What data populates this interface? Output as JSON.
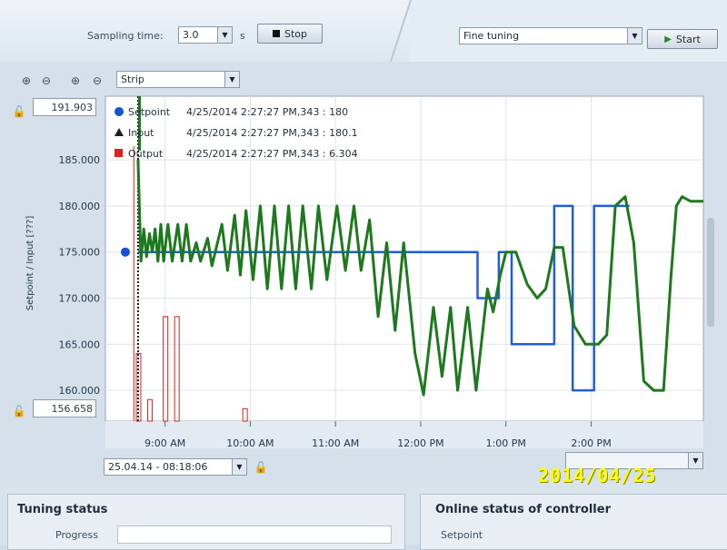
{
  "toolbar": {
    "sampling_label": "Sampling time:",
    "sampling_value": "3.0",
    "unit_label": "s",
    "stop_label": "Stop",
    "tuning_mode_value": "Fine tuning",
    "start_label": "Start",
    "view_mode_value": "Strip"
  },
  "chart": {
    "y_max_readout": "191.903",
    "y_min_readout": "156.658",
    "y_axis_label": "Setpoint / Input  [???]",
    "time_start": "25.04.14 - 08:18:06",
    "legend": [
      {
        "name": "Setpoint",
        "text": "4/25/2014 2:27:27 PM,343 : 180",
        "color": "#1a4fd6",
        "marker": "circle"
      },
      {
        "name": "Input",
        "text": "4/25/2014 2:27:27 PM,343 : 180.1",
        "color": "#1e1e1e",
        "marker": "triangle"
      },
      {
        "name": "Output",
        "text": "4/25/2014 2:27:27 PM,343 : 6.304",
        "color": "#e0201a",
        "marker": "square"
      }
    ]
  },
  "chart_data": {
    "type": "line",
    "ylabel": "Setpoint / Input  [???]",
    "ylim": [
      156.658,
      191.903
    ],
    "y_ticks": [
      "185.000",
      "180.000",
      "175.000",
      "170.000",
      "165.000",
      "160.000"
    ],
    "x_ticks": [
      "9:00 AM",
      "10:00 AM",
      "11:00 AM",
      "12:00 PM",
      "1:00 PM",
      "2:00 PM"
    ],
    "series": [
      {
        "name": "Setpoint",
        "color": "#1f5ce0",
        "points": [
          [
            "8:41",
            175
          ],
          [
            "12:40",
            175
          ],
          [
            "12:40",
            170
          ],
          [
            "12:55",
            170
          ],
          [
            "12:55",
            175
          ],
          [
            "13:04",
            175
          ],
          [
            "13:04",
            165
          ],
          [
            "13:34",
            165
          ],
          [
            "13:34",
            180
          ],
          [
            "13:47",
            180
          ],
          [
            "13:47",
            160
          ],
          [
            "14:02",
            160
          ],
          [
            "14:02",
            180
          ],
          [
            "14:27",
            180
          ]
        ]
      },
      {
        "name": "Input",
        "color": "#1c7a1c",
        "points": [
          [
            "8:41",
            185
          ],
          [
            "8:43",
            174
          ],
          [
            "8:45",
            177.5
          ],
          [
            "8:47",
            174.5
          ],
          [
            "8:49",
            177
          ],
          [
            "8:51",
            175
          ],
          [
            "8:53",
            177.5
          ],
          [
            "8:55",
            174
          ],
          [
            "8:57",
            178
          ],
          [
            "8:59",
            174
          ],
          [
            "9:02",
            178
          ],
          [
            "9:05",
            174
          ],
          [
            "9:09",
            178
          ],
          [
            "9:12",
            174
          ],
          [
            "9:15",
            178
          ],
          [
            "9:18",
            174
          ],
          [
            "9:22",
            176
          ],
          [
            "9:25",
            174
          ],
          [
            "9:30",
            176.5
          ],
          [
            "9:33",
            173.5
          ],
          [
            "9:40",
            178
          ],
          [
            "9:44",
            173
          ],
          [
            "9:49",
            179
          ],
          [
            "9:53",
            172.5
          ],
          [
            "9:57",
            179.5
          ],
          [
            "10:02",
            172
          ],
          [
            "10:07",
            180
          ],
          [
            "10:12",
            171
          ],
          [
            "10:17",
            180
          ],
          [
            "10:22",
            171
          ],
          [
            "10:27",
            180
          ],
          [
            "10:32",
            171
          ],
          [
            "10:37",
            180
          ],
          [
            "10:43",
            171
          ],
          [
            "10:48",
            180
          ],
          [
            "10:54",
            172
          ],
          [
            "11:01",
            180
          ],
          [
            "11:07",
            173
          ],
          [
            "11:13",
            180
          ],
          [
            "11:18",
            173
          ],
          [
            "11:24",
            178.5
          ],
          [
            "11:30",
            168
          ],
          [
            "11:36",
            176
          ],
          [
            "11:42",
            166.5
          ],
          [
            "11:48",
            176
          ],
          [
            "11:56",
            164
          ],
          [
            "12:02",
            159.5
          ],
          [
            "12:09",
            169
          ],
          [
            "12:15",
            161.5
          ],
          [
            "12:21",
            169
          ],
          [
            "12:26",
            160
          ],
          [
            "12:33",
            169
          ],
          [
            "12:39",
            160
          ],
          [
            "12:47",
            171
          ],
          [
            "12:51",
            168.5
          ],
          [
            "12:56",
            172.5
          ],
          [
            "13:00",
            175
          ],
          [
            "13:07",
            175
          ],
          [
            "13:15",
            171.5
          ],
          [
            "13:22",
            170
          ],
          [
            "13:28",
            171
          ],
          [
            "13:34",
            175.5
          ],
          [
            "13:40",
            175.5
          ],
          [
            "13:48",
            167
          ],
          [
            "13:56",
            165
          ],
          [
            "14:05",
            165
          ],
          [
            "14:11",
            166
          ],
          [
            "14:17",
            180
          ],
          [
            "14:24",
            181
          ],
          [
            "14:30",
            176
          ],
          [
            "14:37",
            161
          ],
          [
            "14:44",
            160
          ],
          [
            "14:51",
            160
          ],
          [
            "14:56",
            172
          ],
          [
            "15:00",
            180
          ],
          [
            "15:04",
            181
          ],
          [
            "15:10",
            180.5
          ],
          [
            "15:19",
            180.5
          ]
        ]
      },
      {
        "name": "Output",
        "color": "#e0201a",
        "points": [
          [
            "8:41",
            164
          ],
          [
            "8:49",
            159
          ],
          [
            "9:00",
            168
          ],
          [
            "9:08",
            168
          ],
          [
            "9:56",
            158
          ]
        ]
      }
    ]
  },
  "tuning_status": {
    "title": "Tuning status",
    "progress_label": "Progress"
  },
  "online_status": {
    "title": "Online status of controller",
    "setpoint_label": "Setpoint"
  },
  "stamp": "2014/04/25"
}
